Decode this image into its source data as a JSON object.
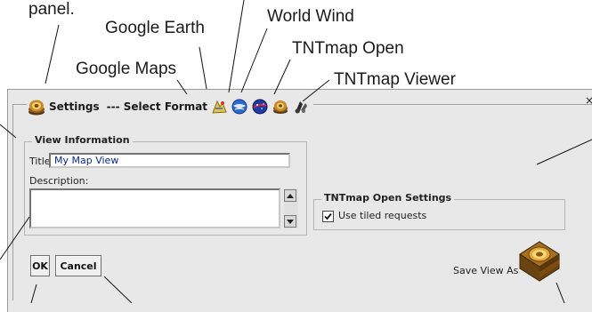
{
  "callouts": {
    "panel": "panel.",
    "google_earth": "Google Earth",
    "world_wind": "World Wind",
    "tntmap_open": "TNTmap Open",
    "google_maps": "Google Maps",
    "tntmap_viewer": "TNTmap Viewer"
  },
  "dialog": {
    "settings_label": "Settings",
    "select_format_label": "--- Select Format",
    "close_glyph": "×",
    "format_icons": [
      "google-maps-icon",
      "google-earth-icon",
      "world-wind-icon",
      "tntmap-open-icon",
      "tntmap-viewer-icon"
    ]
  },
  "view_information": {
    "group_title": "View Information",
    "title_label": "Title:",
    "title_value": "My Map View",
    "description_label": "Description:",
    "description_value": ""
  },
  "tntmap_open_settings": {
    "group_title": "TNTmap Open Settings",
    "use_tiled_label": "Use tiled requests",
    "use_tiled_checked": true
  },
  "buttons": {
    "ok_label": "OK",
    "cancel_label": "Cancel"
  },
  "save_view_as_label": "Save View As"
}
